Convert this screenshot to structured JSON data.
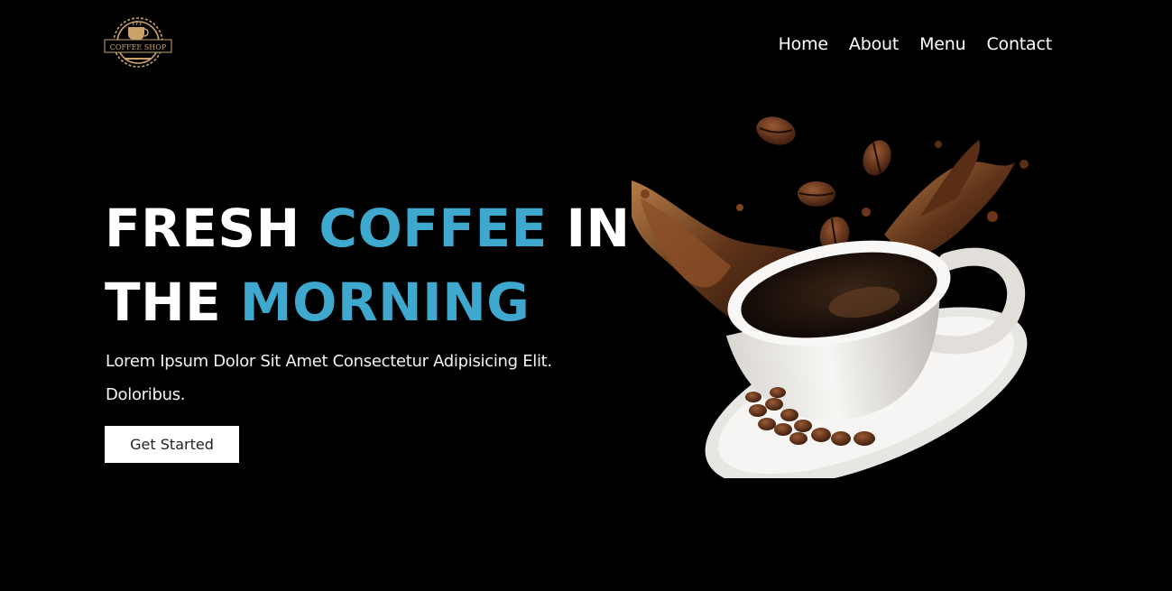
{
  "brand": {
    "logo_text": "COFFEE SHOP"
  },
  "nav": {
    "items": [
      "Home",
      "About",
      "Menu",
      "Contact"
    ]
  },
  "hero": {
    "title_part1": "FRESH ",
    "title_part2": "COFFEE",
    "title_part3": " IN",
    "title_part4": "THE ",
    "title_part5": "MORNING",
    "text_line1": "Lorem Ipsum Dolor Sit Amet Consectetur Adipisicing Elit.",
    "text_line2": "Doloribus.",
    "cta_label": "Get Started"
  },
  "colors": {
    "background": "#000000",
    "accent": "#3fa8cf",
    "text": "#ffffff",
    "logo_gold": "#c9a36a"
  }
}
